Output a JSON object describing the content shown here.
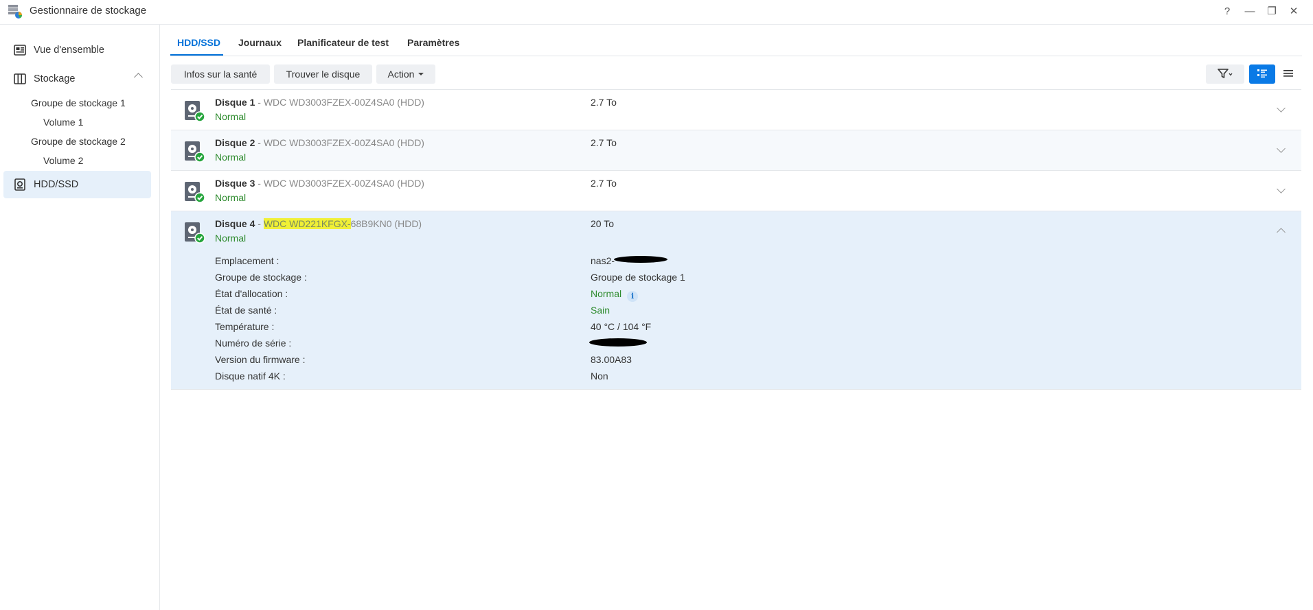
{
  "window": {
    "title": "Gestionnaire de stockage",
    "controls": [
      "?",
      "—",
      "❐",
      "✕"
    ]
  },
  "sidebar": {
    "items": [
      {
        "label": "Vue d'ensemble",
        "icon": "overview-icon"
      },
      {
        "label": "Stockage",
        "icon": "storage-icon"
      },
      {
        "label": "HDD/SSD",
        "icon": "hdd-icon"
      }
    ],
    "subitems": [
      "Groupe de stockage 1",
      "Volume 1",
      "Groupe de stockage 2",
      "Volume 2"
    ]
  },
  "tabs": [
    {
      "label": "HDD/SSD",
      "active": true
    },
    {
      "label": "Journaux"
    },
    {
      "label": "Planificateur de test"
    },
    {
      "label": "Paramètres"
    }
  ],
  "toolbar": {
    "health_info": "Infos sur la santé",
    "find_disk": "Trouver le disque",
    "action": "Action",
    "icons": [
      "filter-icon",
      "card-view-icon",
      "list-view-icon"
    ]
  },
  "disks": [
    {
      "name": "Disque 1",
      "sep": " - ",
      "model": "WDC WD3003FZEX-00Z4SA0 (HDD)",
      "status": "Normal",
      "size": "2.7 To"
    },
    {
      "name": "Disque 2",
      "sep": " - ",
      "model": "WDC WD3003FZEX-00Z4SA0 (HDD)",
      "status": "Normal",
      "size": "2.7 To"
    },
    {
      "name": "Disque 3",
      "sep": " - ",
      "model": "WDC WD3003FZEX-00Z4SA0 (HDD)",
      "status": "Normal",
      "size": "2.7 To"
    },
    {
      "name": "Disque 4",
      "sep": " - ",
      "model_highlight": "WDC WD221KFGX-",
      "model_rest": "68B9KN0 (HDD)",
      "status": "Normal",
      "size": "20 To"
    }
  ],
  "details": [
    {
      "label": "Emplacement :",
      "value": "nas2-"
    },
    {
      "label": "Groupe de stockage :",
      "value": "Groupe de stockage 1"
    },
    {
      "label": "État d'allocation :",
      "value": "Normal",
      "info": "i"
    },
    {
      "label": "État de santé :",
      "value": "Sain"
    },
    {
      "label": "Température :",
      "value": "40 °C / 104 °F"
    },
    {
      "label": "Numéro de série :",
      "value": ""
    },
    {
      "label": "Version du firmware :",
      "value": "83.00A83"
    },
    {
      "label": "Disque natif 4K :",
      "value": "Non"
    }
  ],
  "colors": {
    "accent": "#0070d8",
    "status_green": "#2e8b2e",
    "expanded_bg": "#e6f0fa",
    "highlight": "#f0f036"
  }
}
